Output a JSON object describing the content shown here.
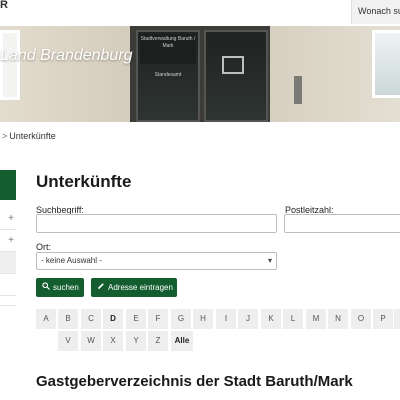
{
  "header": {
    "brand_partial": "R",
    "search_button": "Wonach suchen Sie?",
    "tagline": "Land Brandenburg",
    "hero_sign": "Stadtverwaltung Baruth / Mark",
    "hero_sign2": "Standesamt"
  },
  "breadcrumb": {
    "separator": ">",
    "current": "Unterkünfte"
  },
  "sidebar": {
    "expand_1": "+",
    "expand_2": "+"
  },
  "main": {
    "title": "Unterkünfte",
    "search_label": "Suchbegriff:",
    "search_value": "",
    "zip_label": "Postleitzahl:",
    "zip_value": "",
    "ort_label": "Ort:",
    "ort_selected": "- keine Auswahl -",
    "search_button": "suchen",
    "add_button": "Adresse eintragen",
    "alphabet_row1": [
      "A",
      "B",
      "C",
      "D",
      "E",
      "F",
      "G",
      "H",
      "I",
      "J",
      "K",
      "L",
      "M",
      "N",
      "O",
      "P",
      ""
    ],
    "alphabet_row2": [
      "V",
      "W",
      "X",
      "Y",
      "Z",
      "Alle"
    ],
    "bold_letters": [
      "D",
      "Alle"
    ],
    "directory_title": "Gastgeberverzeichnis der Stadt Baruth/Mark"
  },
  "colors": {
    "accent_green": "#135d2f",
    "letter_bg": "#eeeeee"
  },
  "icons": {
    "search": "magnifier-icon",
    "add": "pencil-icon",
    "select": "chevron-down-icon"
  }
}
